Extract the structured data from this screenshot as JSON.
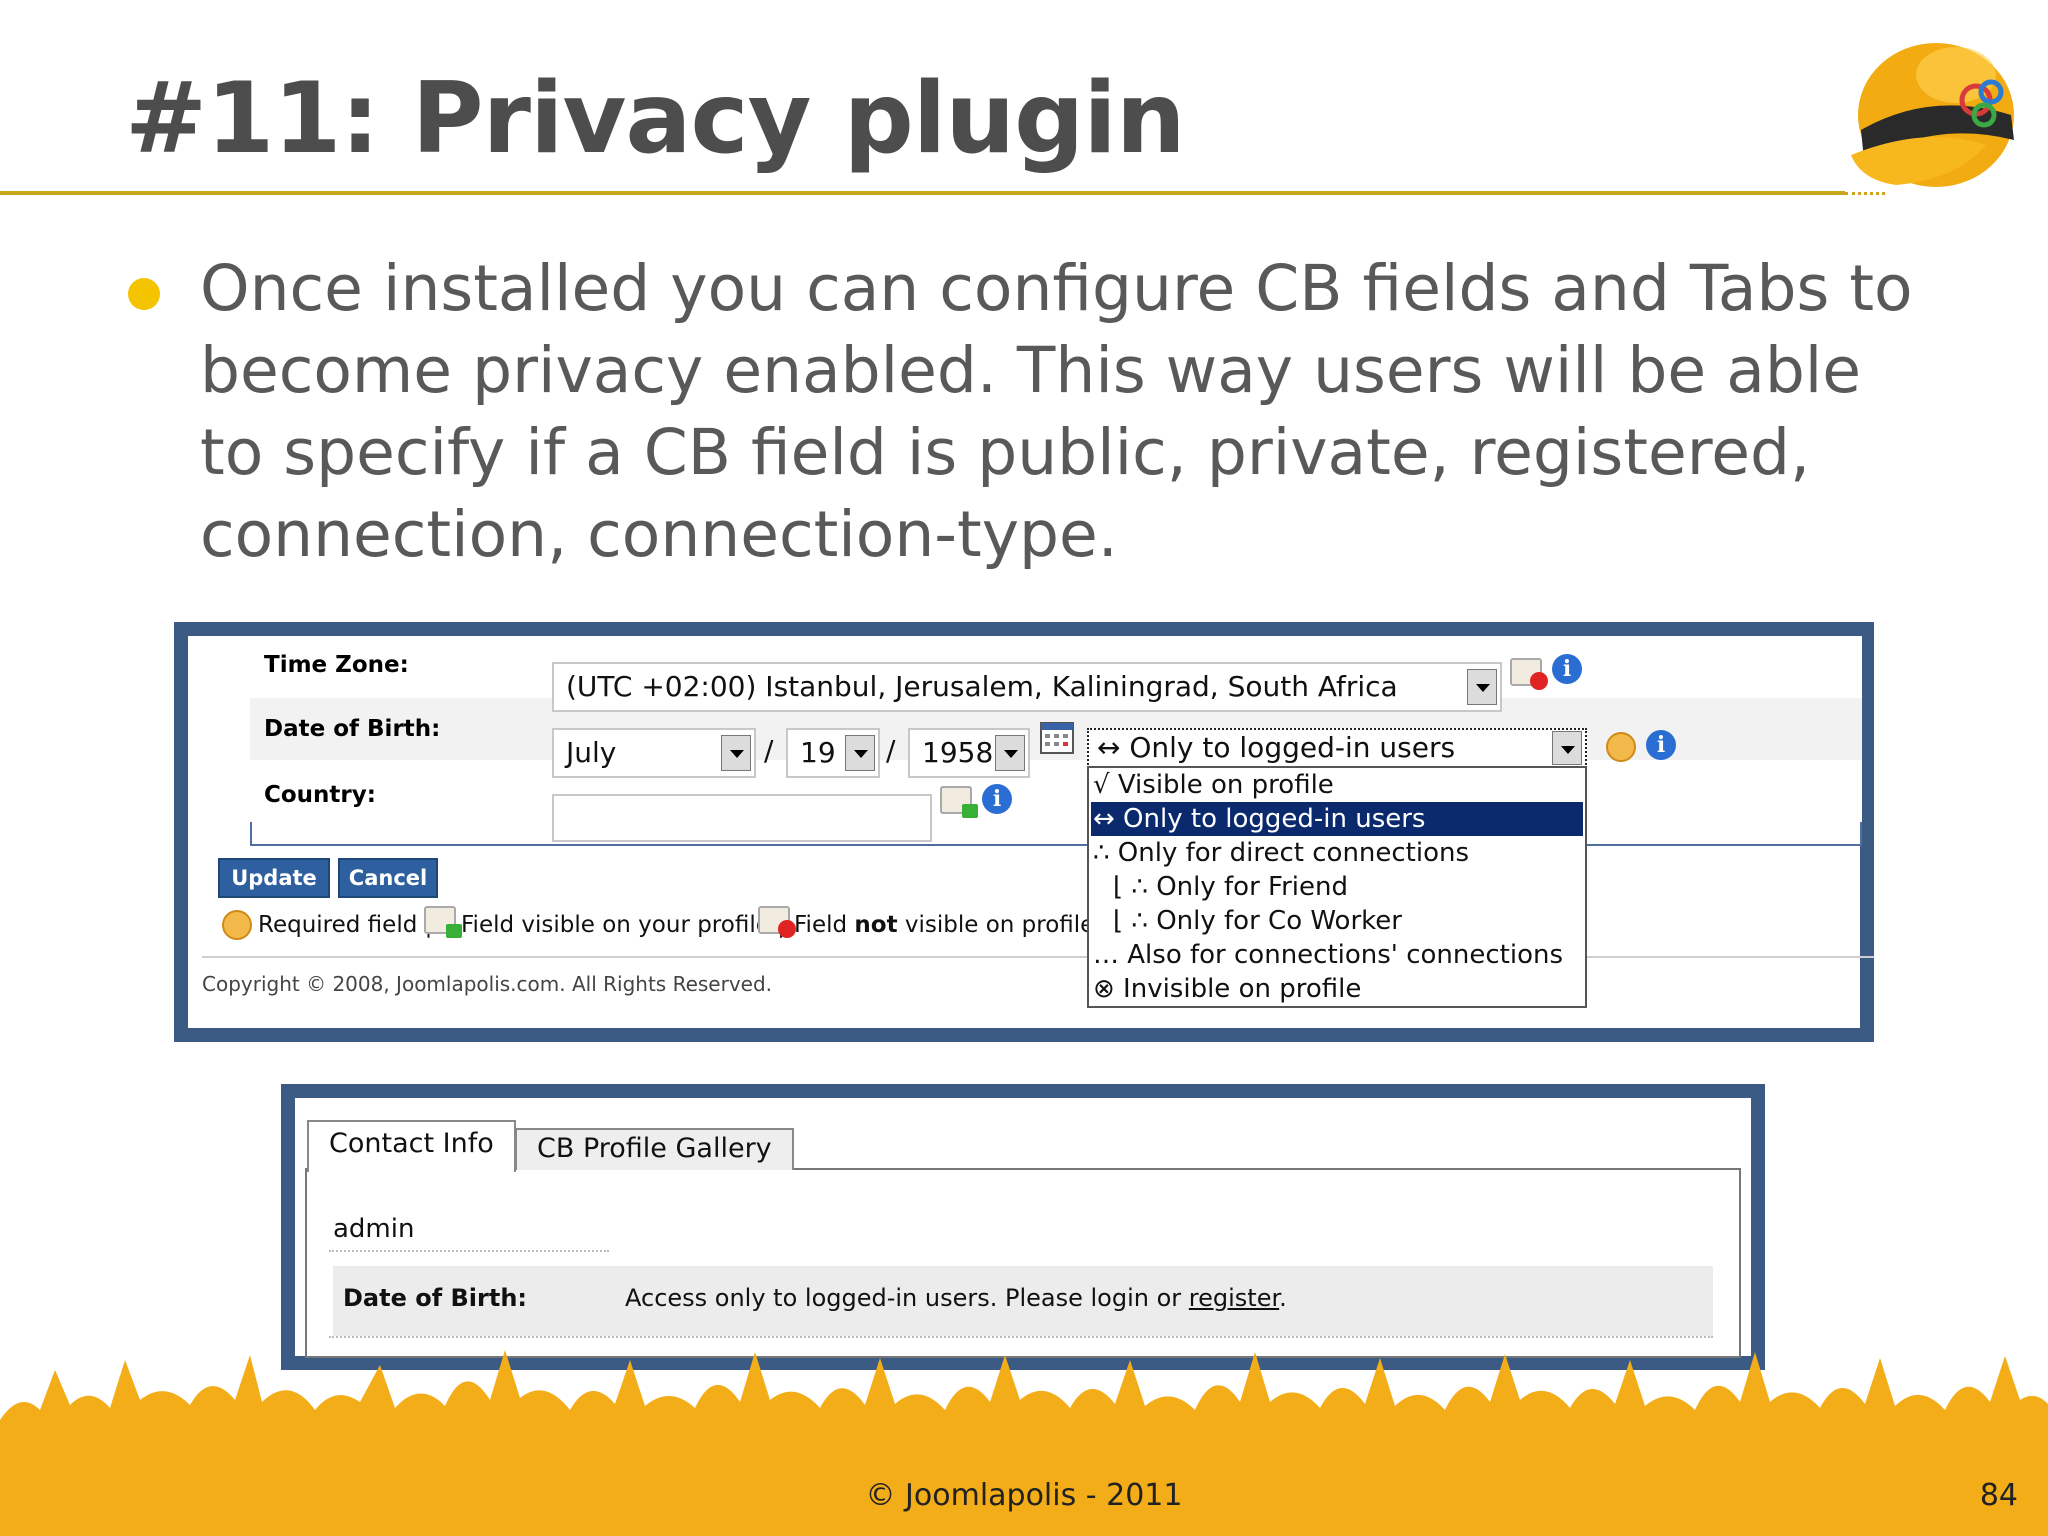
{
  "slide": {
    "title": "#11: Privacy plugin",
    "bullet": "Once installed you can configure CB fields and Tabs to become privacy enabled. This way users will be able to specify if a CB field is public, private, registered, connection, connection-type.",
    "footer": "© Joomlapolis - 2011",
    "page_number": "84",
    "accent_color": "#c9a61c",
    "frame_color": "#3b5b85"
  },
  "profile_form": {
    "time_zone": {
      "label": "Time Zone:",
      "value": "(UTC +02:00) Istanbul, Jerusalem, Kaliningrad, South Africa"
    },
    "date_of_birth": {
      "label": "Date of Birth:",
      "month": "July",
      "day": "19",
      "year": "1958",
      "separator": "/",
      "privacy_selected": "↔ Only to logged-in users"
    },
    "country": {
      "label": "Country:",
      "value": ""
    },
    "buttons": {
      "update": "Update",
      "cancel": "Cancel"
    },
    "legend": {
      "required": "Required field |",
      "visible": "Field visible on your profile |",
      "not_visible_pre": "Field ",
      "not_visible_bold": "not",
      "not_visible_post": " visible on profile |"
    },
    "copyright": "Copyright © 2008, Joomlapolis.com. All Rights Reserved.",
    "privacy_options": [
      "√ Visible on profile",
      "↔ Only to logged-in users",
      "∴ Only for direct connections",
      "⌊ ∴ Only for Friend",
      "⌊ ∴ Only for Co Worker",
      "… Also for connections' connections",
      "⊗ Invisible on profile"
    ]
  },
  "profile_view": {
    "tabs": [
      "Contact Info",
      "CB Profile Gallery"
    ],
    "username": "admin",
    "dob_label": "Date of Birth:",
    "dob_message": "Access only to logged-in users. Please login or ",
    "dob_link": "register",
    "dob_end": "."
  },
  "icons": [
    "helmet-logo",
    "bullet-dot",
    "dropdown-arrow-icon",
    "calendar-icon",
    "required-icon",
    "field-visible-icon",
    "field-not-visible-icon",
    "info-icon",
    "crowd-silhouette"
  ]
}
